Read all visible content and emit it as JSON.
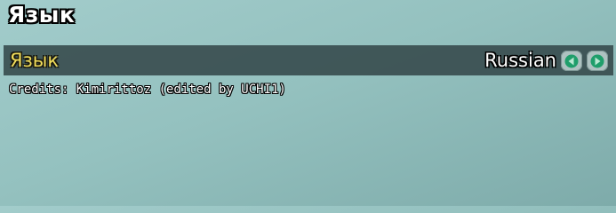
{
  "header": {
    "title": "Язык"
  },
  "language_option": {
    "label": "Язык",
    "value": "Russian"
  },
  "credits": {
    "text": "Credits: Kimirittoz (edited by UCHI1)"
  },
  "icons": {
    "prev": "arrow-left-icon",
    "next": "arrow-right-icon"
  },
  "colors": {
    "label": "#f0dc5a",
    "arrow_fill": "#1f9e6b",
    "row_background": "#34484a"
  }
}
